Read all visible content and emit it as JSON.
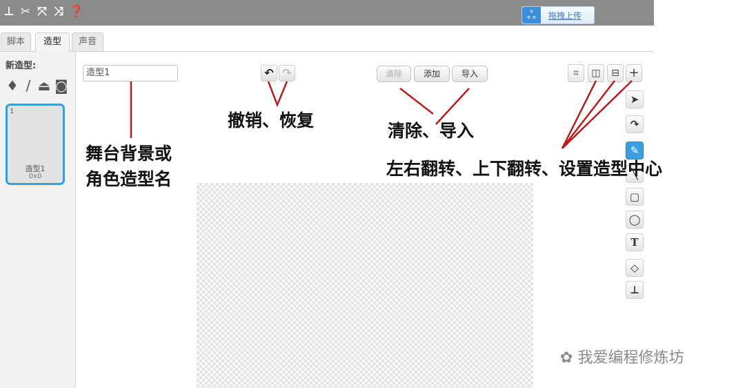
{
  "toolbar": {
    "icons": [
      "stamp-icon",
      "cut-icon",
      "grow-icon",
      "shrink-icon",
      "help-icon"
    ],
    "upload_label": "拖拽上传"
  },
  "tabs": [
    {
      "label": "脚本"
    },
    {
      "label": "造型"
    },
    {
      "label": "声音"
    }
  ],
  "active_tab": 1,
  "left_panel": {
    "new_costume_label": "新造型:",
    "icons": [
      "paint-icon",
      "brush-icon",
      "upload-icon",
      "camera-icon"
    ],
    "costume": {
      "number": "1",
      "name": "造型1",
      "size": "0x0"
    }
  },
  "editor": {
    "name_value": "造型1",
    "clear_label": "清除",
    "add_label": "添加",
    "import_label": "导入"
  },
  "tools": [
    "select-tool",
    "reshape-tool",
    "pencil-tool",
    "line-tool",
    "rectangle-tool",
    "ellipse-tool",
    "text-tool",
    "fill-tool",
    "stamp-tool"
  ],
  "annotations": {
    "name_note_line1": "舞台背景或",
    "name_note_line2": "角色造型名",
    "undo_note": "撤销、恢复",
    "clear_note": "清除、导入",
    "flip_note": "左右翻转、上下翻转、设置造型中心"
  },
  "watermark": "我爱编程修炼坊",
  "colors": {
    "topbar": "#8b8b8b",
    "selected": "#2ea1e0",
    "annotation_line": "#b81b1b"
  }
}
